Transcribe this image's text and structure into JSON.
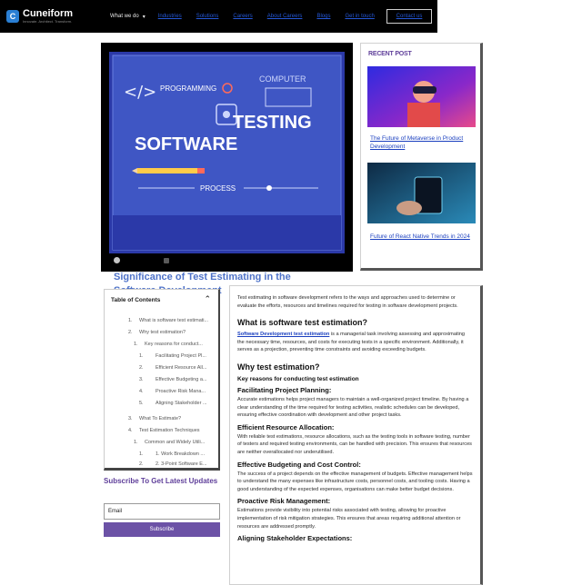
{
  "navbar": {
    "logo_name": "Cuneiform",
    "logo_tag": "Innovate. Architect. Transform.",
    "what_we_do": "What we do",
    "links": [
      "Industries",
      "Solutions",
      "Careers",
      "About Careers",
      "Blogs",
      "Get in touch"
    ],
    "cta": "Contact us"
  },
  "hero": {
    "image_text": {
      "programming": "PROGRAMMING",
      "computer": "COMPUTER",
      "testing": "TESTING",
      "software": "SOFTWARE",
      "process": "PROCESS"
    },
    "title": "Significance of Test Estimating in the Software Development"
  },
  "recent": {
    "heading": "RECENT POST",
    "posts": [
      {
        "title": "The Future of Metaverse in Product Development"
      },
      {
        "title": "Future of React Native Trends in 2024"
      }
    ]
  },
  "toc": {
    "title": "Table of Contents",
    "items": [
      {
        "num": "1.",
        "label": "What is software test estimati..."
      },
      {
        "num": "2.",
        "label": "Why test estimation?"
      },
      {
        "num": "1.",
        "label": "Key reasons for conduct..."
      },
      {
        "num": "1.",
        "label": "Facilitating Project Pl..."
      },
      {
        "num": "2.",
        "label": "Efficient Resource All..."
      },
      {
        "num": "3.",
        "label": "Effective Budgeting a..."
      },
      {
        "num": "4.",
        "label": "Proactive Risk Mana..."
      },
      {
        "num": "5.",
        "label": "Aligning Stakeholder ..."
      },
      {
        "num": "3.",
        "label": "What To Estimate?"
      },
      {
        "num": "4.",
        "label": "Test Estimation Techniques"
      },
      {
        "num": "1.",
        "label": "Common and Widely Utili..."
      },
      {
        "num": "1.",
        "label": "1. Work Breakdown ..."
      },
      {
        "num": "2.",
        "label": "2. 3-Point Software E..."
      }
    ]
  },
  "subscribe": {
    "heading": "Subscribe To Get Latest Updates",
    "placeholder": "Email",
    "button": "Subscribe"
  },
  "article": {
    "intro": "Test estimating in software development refers to the ways and approaches used to determine or evaluate the efforts, resources and timelines required for testing in software development projects.",
    "h_what": "What is software test estimation?",
    "what_link": "Software Development test estimation",
    "what_body": " is a managerial task involving assessing and approximating the necessary time, resources, and costs for executing tests in a specific environment. Additionally, it serves as a projection, preventing time constraints and avoiding exceeding budgets.",
    "h_why": "Why test estimation?",
    "h_key": "Key reasons for conducting test estimation",
    "h_facilitating": "Facilitating Project Planning:",
    "facilitating_body": "Accurate estimations helps project managers to maintain a well-organized project timeline. By having a clear understanding of the time required for testing activities, realistic schedules can be developed, ensuring effective coordination with development and other project tasks.",
    "h_efficient": "Efficient Resource Allocation:",
    "efficient_body": "With reliable test estimations, resource allocations, such as the testing tools in software testing, number of testers and required testing environments, can be handled with precision. This ensures that resources are neither overallocated nor underutilised.",
    "h_budget": "Effective Budgeting and Cost Control:",
    "budget_body": "The success of a project depends on the effective management of budgets. Effective management helps to understand the many expenses like infrastructure costs, personnel costs, and tooling costs. Having a good understanding of the expected expenses, organisations can make better budget decisions.",
    "h_risk": "Proactive Risk Management:",
    "risk_body": "Estimations provide visibility into potential risks associated with testing, allowing for proactive implementation of risk mitigation strategies. This ensures that areas requiring additional attention or resources are addressed promptly.",
    "h_align": "Aligning Stakeholder Expectations:"
  }
}
